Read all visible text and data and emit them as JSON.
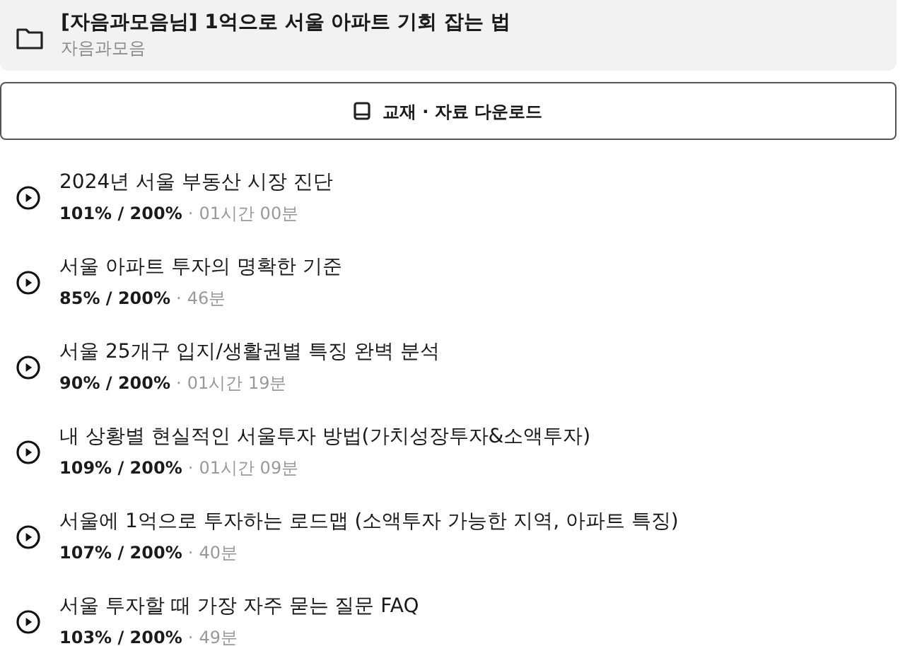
{
  "course": {
    "title": "[자음과모음님] 1억으로 서울 아파트 기회 잡는 법",
    "author": "자음과모음"
  },
  "download_button": {
    "label": "교재 · 자료 다운로드"
  },
  "lessons": [
    {
      "title": "2024년 서울 부동산 시장 진단",
      "progress": "101% / 200%",
      "separator": "·",
      "duration": "01시간 00분"
    },
    {
      "title": "서울 아파트 투자의 명확한 기준",
      "progress": "85% / 200%",
      "separator": "·",
      "duration": "46분"
    },
    {
      "title": "서울 25개구 입지/생활권별 특징 완벽 분석",
      "progress": "90% / 200%",
      "separator": "·",
      "duration": "01시간 19분"
    },
    {
      "title": "내 상황별 현실적인 서울투자 방법(가치성장투자&소액투자)",
      "progress": "109% / 200%",
      "separator": "·",
      "duration": "01시간 09분"
    },
    {
      "title": "서울에 1억으로 투자하는 로드맵 (소액투자 가능한 지역, 아파트 특징)",
      "progress": "107% / 200%",
      "separator": "·",
      "duration": "40분"
    },
    {
      "title": "서울 투자할 때 가장 자주 묻는 질문 FAQ",
      "progress": "103% / 200%",
      "separator": "·",
      "duration": "49분"
    }
  ]
}
